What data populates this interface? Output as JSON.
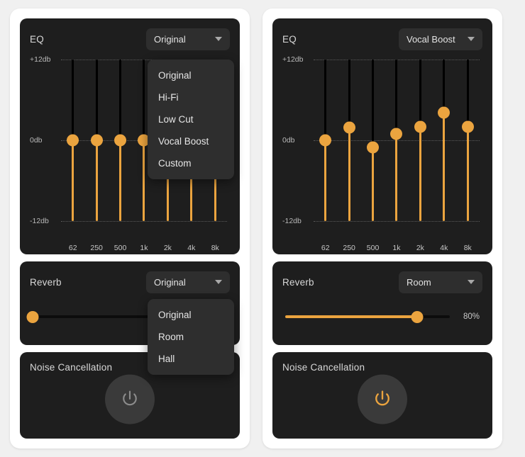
{
  "colors": {
    "accent": "#eba43f",
    "panel_bg": "#1e1e1e",
    "card_bg": "#ffffff",
    "page_bg": "#f0f0f0",
    "control_bg": "#2e2e2e",
    "track_bg": "#000000",
    "power_off": "#8c8c8c",
    "power_on": "#eba43f"
  },
  "eq": {
    "title": "EQ",
    "axis_labels": {
      "top": "+12db",
      "middle": "0db",
      "bottom": "-12db"
    },
    "frequencies": [
      "62",
      "250",
      "500",
      "1k",
      "2k",
      "4k",
      "8k"
    ],
    "presets": [
      "Original",
      "Hi-Fi",
      "Low Cut",
      "Vocal Boost",
      "Custom"
    ],
    "caret_icon": "chevron-down-icon"
  },
  "reverb": {
    "title": "Reverb",
    "presets": [
      "Original",
      "Room",
      "Hall"
    ]
  },
  "noise_cancellation": {
    "title": "Noise Cancellation",
    "power_icon": "power-icon"
  },
  "left_panel": {
    "eq": {
      "selected_preset": "Original",
      "menu_open": true,
      "values_db": [
        0,
        0,
        0,
        0,
        0,
        0,
        0
      ]
    },
    "reverb": {
      "selected_preset": "Original",
      "menu_open": true,
      "amount_percent": 0,
      "amount_label": ""
    },
    "noise_cancellation": {
      "enabled": false
    }
  },
  "right_panel": {
    "eq": {
      "selected_preset": "Vocal Boost",
      "menu_open": false,
      "values_db": [
        0,
        1.9,
        -1.1,
        1.0,
        2.0,
        4.1,
        2.0
      ]
    },
    "reverb": {
      "selected_preset": "Room",
      "menu_open": false,
      "amount_percent": 80,
      "amount_label": "80%"
    },
    "noise_cancellation": {
      "enabled": true
    }
  },
  "chart_data": {
    "type": "bar",
    "title": "EQ",
    "xlabel": "",
    "ylabel": "db",
    "ylim": [
      -12,
      12
    ],
    "categories": [
      "62",
      "250",
      "500",
      "1k",
      "2k",
      "4k",
      "8k"
    ],
    "ytick_labels": [
      "+12db",
      "0db",
      "-12db"
    ],
    "grid": true,
    "legend": "none",
    "series": [
      {
        "name": "Original",
        "values": [
          0,
          0,
          0,
          0,
          0,
          0,
          0
        ]
      },
      {
        "name": "Vocal Boost",
        "values": [
          0,
          1.9,
          -1.1,
          1.0,
          2.0,
          4.1,
          2.0
        ]
      }
    ]
  }
}
